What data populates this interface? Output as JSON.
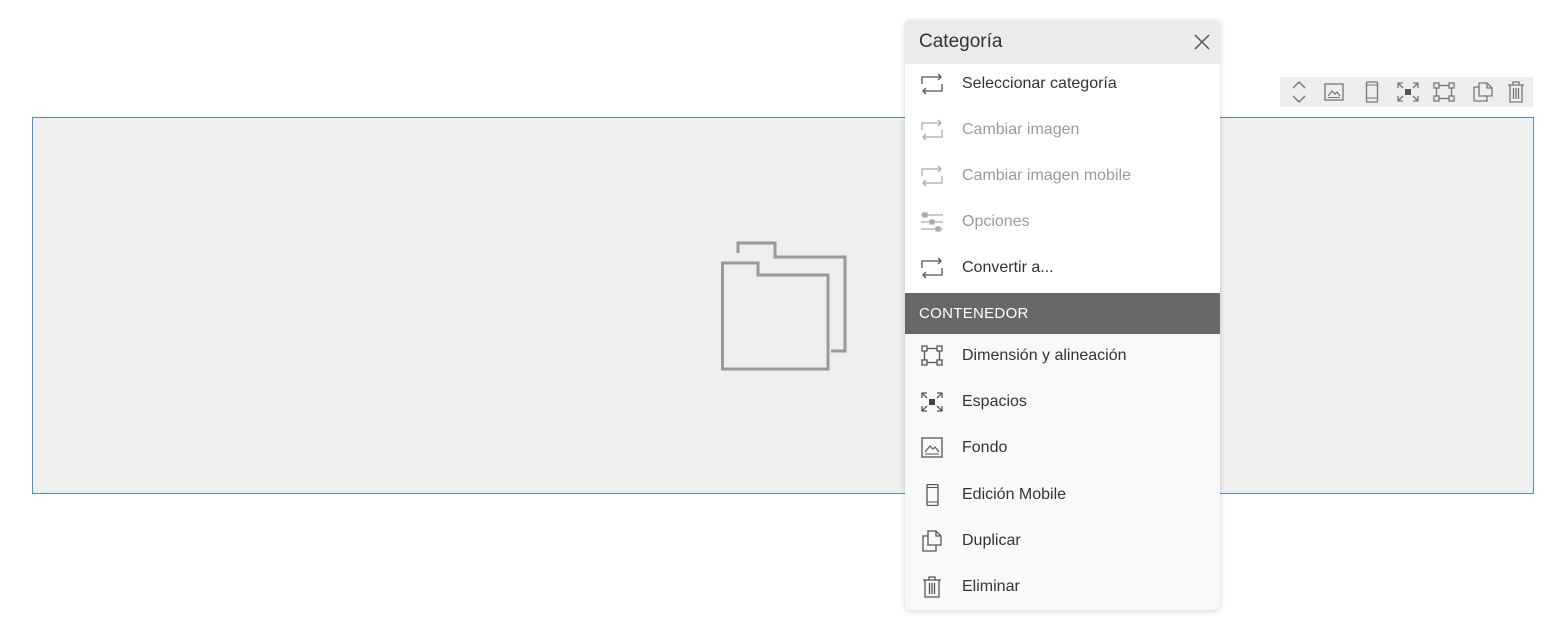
{
  "colors": {
    "selection_border": "#4a90d9",
    "block_background": "#efefef",
    "menu_header_bg": "#ebebeb",
    "section_header_bg": "#686868",
    "disabled_text": "#9a9a9a"
  },
  "block": {
    "placeholder_icon": "folder-icon"
  },
  "toolbar": {
    "buttons": [
      {
        "icon": "move-up-down-icon"
      },
      {
        "icon": "image-icon"
      },
      {
        "icon": "mobile-icon"
      },
      {
        "icon": "spacing-icon"
      },
      {
        "icon": "dimension-icon"
      },
      {
        "icon": "duplicate-icon"
      },
      {
        "icon": "trash-icon"
      }
    ]
  },
  "menu": {
    "title": "Categoría",
    "close_icon": "close-icon",
    "items": [
      {
        "label": "Seleccionar categoría",
        "icon": "swap-icon",
        "enabled": true
      },
      {
        "label": "Cambiar imagen",
        "icon": "swap-icon",
        "enabled": false
      },
      {
        "label": "Cambiar imagen mobile",
        "icon": "swap-icon",
        "enabled": false
      },
      {
        "label": "Opciones",
        "icon": "sliders-icon",
        "enabled": false
      },
      {
        "label": "Convertir a...",
        "icon": "swap-icon",
        "enabled": true
      }
    ],
    "section_title": "CONTENEDOR",
    "container_items": [
      {
        "label": "Dimensión y alineación",
        "icon": "dimension-icon"
      },
      {
        "label": "Espacios",
        "icon": "spacing-icon"
      },
      {
        "label": "Fondo",
        "icon": "image-icon"
      },
      {
        "label": "Edición Mobile",
        "icon": "mobile-icon"
      },
      {
        "label": "Duplicar",
        "icon": "duplicate-icon"
      },
      {
        "label": "Eliminar",
        "icon": "trash-icon"
      }
    ]
  }
}
